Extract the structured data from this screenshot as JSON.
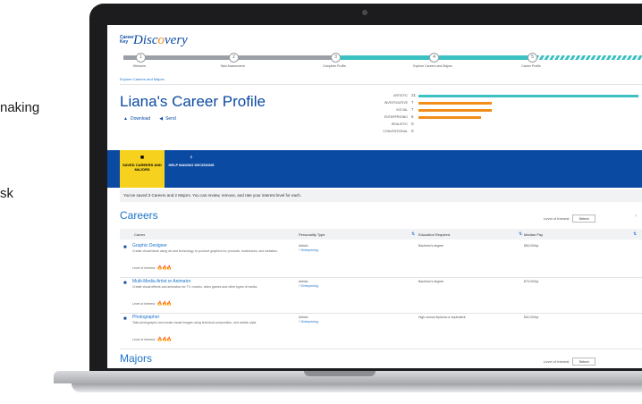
{
  "side_texts": [
    "naking",
    "sk"
  ],
  "app": {
    "logo_small": "Career Key",
    "logo_main_1": "Disc",
    "logo_main_2": "o",
    "logo_main_3": "very"
  },
  "progress": {
    "steps": [
      {
        "num": "1",
        "label": "Welcome"
      },
      {
        "num": "2",
        "label": "Take Assessment"
      },
      {
        "num": "3",
        "label": "Complete Profile"
      },
      {
        "num": "4",
        "label": "Explore Careers and Majors"
      },
      {
        "num": "5",
        "label": "Career Profile"
      }
    ]
  },
  "breadcrumb": "Explore Careers and Majors",
  "profile": {
    "title": "Liana's Career Profile",
    "download_label": "Download",
    "send_label": "Send"
  },
  "traits": [
    {
      "label": "ARTISTIC",
      "value": 21,
      "color": "#3cc1c3"
    },
    {
      "label": "INVESTIGATIVE",
      "value": 7,
      "color": "#f28c1b"
    },
    {
      "label": "SOCIAL",
      "value": 7,
      "color": "#f28c1b"
    },
    {
      "label": "ENTERPRISING",
      "value": 6,
      "color": "#f28c1b"
    },
    {
      "label": "REALISTIC",
      "value": 0,
      "color": "#f28c1b"
    },
    {
      "label": "CONVENTIONAL",
      "value": 0,
      "color": "#f28c1b"
    }
  ],
  "tabs": {
    "saved": "SAVED CAREERS AND MAJORS",
    "help": "HELP MAKING DECISIONS"
  },
  "info_text": "You've saved 3 Careers and 2 Majors. You can review, remove, and rate your interest level for each.",
  "careers": {
    "heading": "Careers",
    "interest_label": "Level of Interest",
    "interest_value": "Select",
    "columns": [
      "Career",
      "Personality Type",
      "Education Required",
      "Median Pay"
    ],
    "rows": [
      {
        "title": "Graphic Designer",
        "desc": "Create visual ideas using art and technology to produce graphics for products, businesses, and websites.",
        "level_label": "Level of Interest:",
        "flames": "🔥🔥🔥",
        "flame_color": "orange",
        "type_primary": "Artistic",
        "type_secondary": "+ Enterprising",
        "education": "Bachelor's degree",
        "pay": "$50,000/yr"
      },
      {
        "title": "Multi-Media Artist or Animator",
        "desc": "Create visual effects and animation for TV, movies, video games and other types of media.",
        "level_label": "Level of Interest:",
        "flames": "🔥🔥🔥",
        "flame_color": "orange",
        "type_primary": "Artistic",
        "type_secondary": "+ Enterprising",
        "education": "Bachelor's degree",
        "pay": "$70,000/yr"
      },
      {
        "title": "Photographer",
        "desc": "Take photographs and create visual images using technical composition, and artistic style.",
        "level_label": "Level of Interest:",
        "flames": "🔥🔥🔥",
        "flame_color": "navy",
        "type_primary": "Artistic",
        "type_secondary": "+ Enterprising",
        "education": "High school diploma or equivalent",
        "pay": "$32,000/yr"
      }
    ]
  },
  "majors": {
    "heading": "Majors",
    "interest_label": "Level of Interest",
    "interest_value": "Select"
  }
}
